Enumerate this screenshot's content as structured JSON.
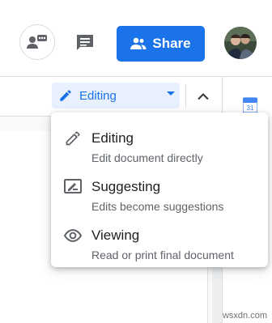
{
  "header": {
    "share_label": "Share",
    "share_color": "#1a73e8"
  },
  "toolbar": {
    "mode_label": "Editing"
  },
  "menu": {
    "items": [
      {
        "title": "Editing",
        "description": "Edit document directly",
        "icon": "pencil-icon"
      },
      {
        "title": "Suggesting",
        "description": "Edits become suggestions",
        "icon": "suggest-icon"
      },
      {
        "title": "Viewing",
        "description": "Read or print final document",
        "icon": "eye-icon"
      }
    ]
  },
  "side_panel": {
    "calendar_day": "31"
  },
  "watermark": "wsxdn.com"
}
